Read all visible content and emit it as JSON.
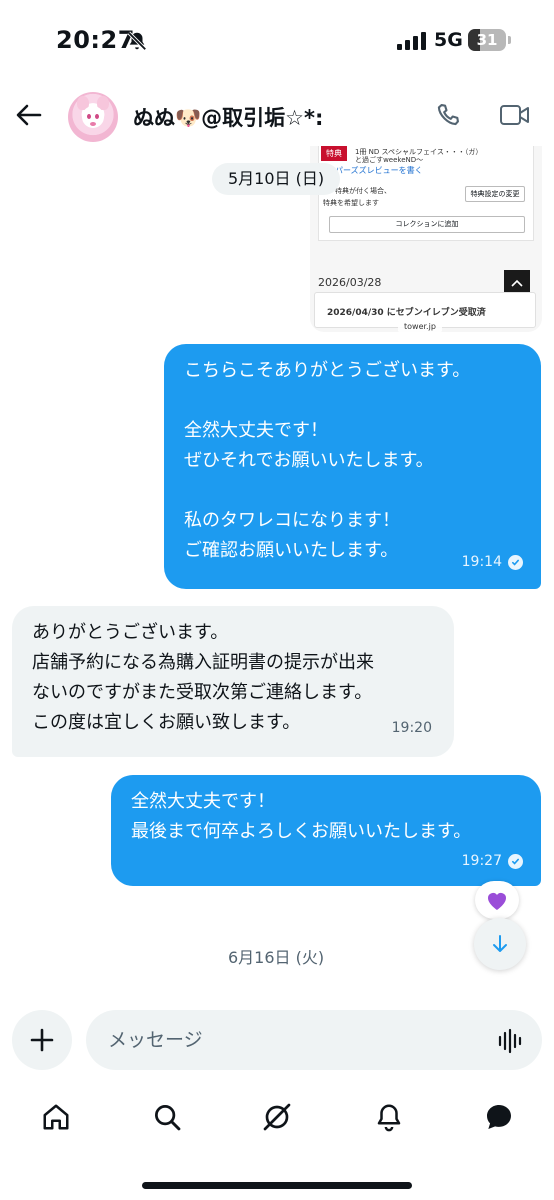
{
  "status_bar": {
    "time": "20:27",
    "network": "5G",
    "battery_percent": "31",
    "battery_level": 0.31
  },
  "header": {
    "contact_name": "ぬぬ🐶@取引垢☆*:"
  },
  "shared_card": {
    "badge": "特典",
    "tagline": "1冊 ND スペシャルフェイス・・・（ガ）",
    "subline": "と過ごすweekeND〜",
    "review_link": "パーズズレビューを書く",
    "bonus_note_1": "特典が付く場合、",
    "bonus_note_2": "特典を希望します",
    "settings_button": "特典設定の変更",
    "collection_button": "コレクションに追加",
    "date": "2026/03/28",
    "order_status": "2026/04/30 にセブンイレブン受取済",
    "domain": "tower.jp"
  },
  "chat": {
    "date_chip_1": "5月10日 (日)",
    "date_chip_2": "6月16日 (火)",
    "messages": [
      {
        "direction": "out",
        "line1": "こちらこそありがとうございます。",
        "line2": "全然大丈夫です！",
        "line3": "ぜひそれでお願いいたします。",
        "line4": "私のタワレコになります！",
        "line5": "ご確認お願いいたします。",
        "time": "19:14"
      },
      {
        "direction": "in",
        "line1": "ありがとうございます。",
        "line2": "店舗予約になる為購入証明書の提示が出来",
        "line3": "ないのですがまた受取次第ご連絡します。",
        "line4": "この度は宜しくお願い致します。",
        "time": "19:20"
      },
      {
        "direction": "out",
        "line1": "全然大丈夫です！",
        "line2": "最後まで何卒よろしくお願いいたします。",
        "time": "19:27",
        "reaction": "💜"
      }
    ]
  },
  "composer": {
    "placeholder": "メッセージ"
  },
  "icons": {
    "back": "back-arrow-icon",
    "call": "phone-icon",
    "video": "video-camera-icon",
    "add": "plus-icon",
    "voice": "voice-wave-icon",
    "scroll_down": "arrow-down-icon",
    "tabs": [
      "home-icon",
      "search-icon",
      "grok-icon",
      "bell-icon",
      "messages-icon"
    ]
  },
  "colors": {
    "outgoing_bubble": "#1d9bf0",
    "incoming_bubble": "#eff3f4",
    "text": "#0f1419",
    "muted": "#536471"
  }
}
